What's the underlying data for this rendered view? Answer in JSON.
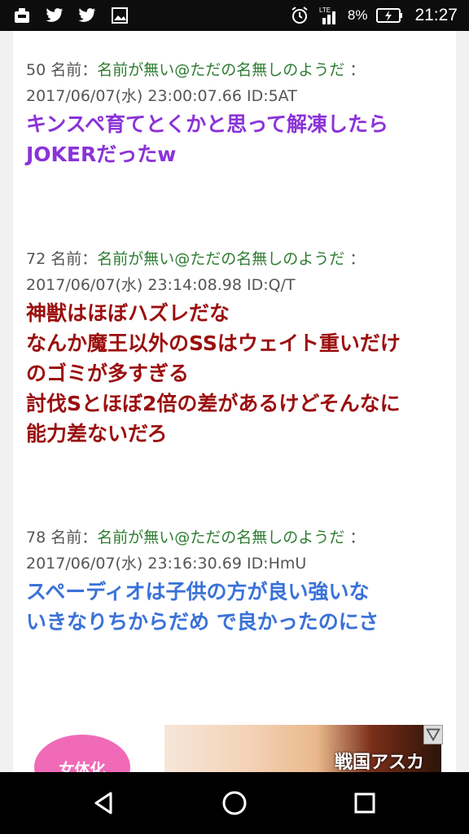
{
  "status_bar": {
    "battery_percent": "8%",
    "time": "21:27",
    "network": "LTE",
    "left_icons": [
      "notification-icon",
      "twitter-icon",
      "twitter-icon",
      "image-icon"
    ],
    "right_icons": [
      "alarm-icon",
      "signal-icon",
      "battery-icon"
    ]
  },
  "posts": [
    {
      "number": "50",
      "name_label": "名前：",
      "name": "名前が無い@ただの名無しのようだ",
      "sep": "：",
      "date_line": "2017/06/07(水) 23:00:07.66 ID:5AT",
      "body": "キンスペ育てとくかと思って解凍したら\nJOKERだったw",
      "color": "#8b33d8"
    },
    {
      "number": "72",
      "name_label": "名前：",
      "name": "名前が無い@ただの名無しのようだ",
      "sep": "：",
      "date_line": "2017/06/07(水) 23:14:08.98 ID:Q/T",
      "body": "神獣はほぼハズレだな\nなんか魔王以外のSSはウェイト重いだけ\nのゴミが多すぎる\n討伐Sとほぼ2倍の差があるけどそんなに\n能力差ないだろ",
      "color": "#9b0f0f"
    },
    {
      "number": "78",
      "name_label": "名前：",
      "name": "名前が無い@ただの名無しのようだ",
      "sep": "：",
      "date_line": "2017/06/07(水) 23:16:30.69 ID:HmU",
      "body": "スペーディオは子供の方が良い強いな\nいきなりちからだめ で良かったのにさ",
      "color": "#3a72d8"
    }
  ],
  "ad": {
    "badge": "女体化",
    "title": "戦国アスカ"
  },
  "nav": {
    "icons": [
      "back-icon",
      "home-icon",
      "recents-icon"
    ]
  }
}
